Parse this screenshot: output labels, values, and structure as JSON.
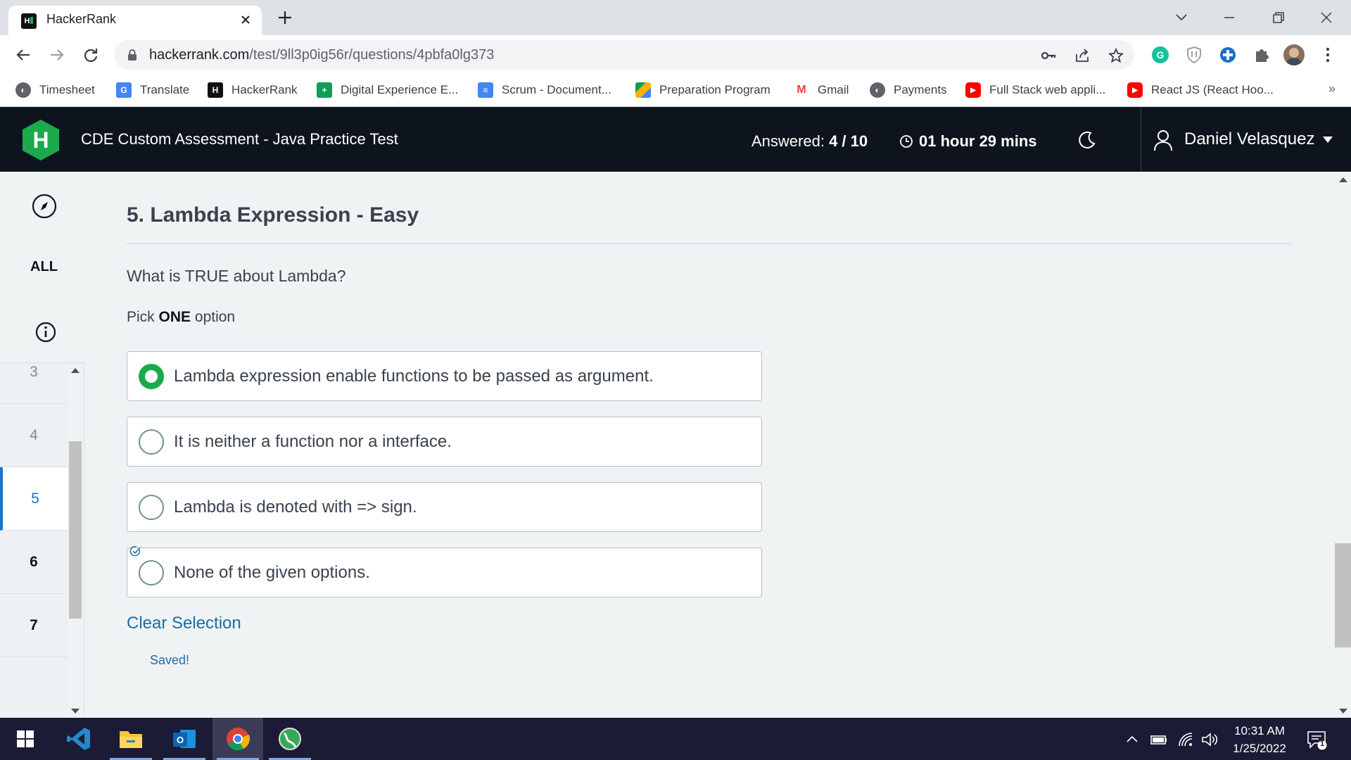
{
  "browser": {
    "tab_title": "HackerRank",
    "url_domain": "hackerrank.com",
    "url_path": "/test/9ll3p0ig56r/questions/4pbfa0lg373"
  },
  "bookmarks": [
    {
      "label": "Timesheet",
      "icon": "globe-icon"
    },
    {
      "label": "Translate",
      "icon": "google-translate-icon"
    },
    {
      "label": "HackerRank",
      "icon": "hackerrank-icon"
    },
    {
      "label": "Digital Experience E...",
      "icon": "google-sheets-icon"
    },
    {
      "label": "Scrum - Document...",
      "icon": "google-docs-icon"
    },
    {
      "label": "Preparation Program",
      "icon": "google-drive-icon"
    },
    {
      "label": "Gmail",
      "icon": "gmail-icon"
    },
    {
      "label": "Payments",
      "icon": "globe-icon"
    },
    {
      "label": "Full Stack web appli...",
      "icon": "youtube-icon"
    },
    {
      "label": "React JS (React Hoo...",
      "icon": "youtube-icon"
    }
  ],
  "header": {
    "test_title": "CDE Custom Assessment - Java Practice Test",
    "answered_label": "Answered:",
    "answered_value": "4 / 10",
    "timer": "01 hour 29 mins",
    "user_name": "Daniel Velasquez"
  },
  "rail": {
    "all_label": "ALL",
    "questions": [
      {
        "num": "3",
        "state": "unanswered"
      },
      {
        "num": "4",
        "state": "unanswered"
      },
      {
        "num": "5",
        "state": "active"
      },
      {
        "num": "6",
        "state": "answered"
      },
      {
        "num": "7",
        "state": "answered"
      }
    ]
  },
  "question": {
    "title": "5. Lambda Expression - Easy",
    "text": "What is TRUE about Lambda?",
    "pick_prefix": "Pick",
    "pick_bold": "ONE",
    "pick_suffix": "option",
    "options": [
      {
        "label": "Lambda expression enable functions to be passed as argument.",
        "selected": true
      },
      {
        "label": "It is neither a function nor a interface.",
        "selected": false
      },
      {
        "label": "Lambda is denoted with => sign.",
        "selected": false
      },
      {
        "label": "None of the given options.",
        "selected": false
      }
    ],
    "clear_label": "Clear Selection",
    "saved_label": "Saved!"
  },
  "taskbar": {
    "time": "10:31 AM",
    "date": "1/25/2022",
    "notification_count": "1"
  },
  "colors": {
    "hr_green": "#1ba94c",
    "header_bg": "#0e141e",
    "link_blue": "#1a6ea8"
  }
}
